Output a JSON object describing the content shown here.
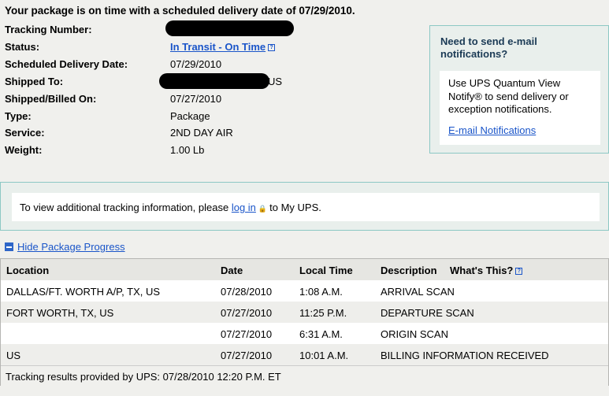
{
  "headline": "Your package is on time with a scheduled delivery date of 07/29/2010.",
  "details": [
    {
      "label": "Tracking Number:",
      "value": ""
    },
    {
      "label": "Status:",
      "value": "In Transit - On Time"
    },
    {
      "label": "Scheduled Delivery Date:",
      "value": "07/29/2010"
    },
    {
      "label": "Shipped To:",
      "value": "US"
    },
    {
      "label": "Shipped/Billed On:",
      "value": "07/27/2010"
    },
    {
      "label": "Type:",
      "value": "Package"
    },
    {
      "label": "Service:",
      "value": "2ND DAY AIR"
    },
    {
      "label": "Weight:",
      "value": "1.00 Lb"
    }
  ],
  "help_icon": "?",
  "notify": {
    "title": "Need to send e-mail notifications?",
    "text": "Use UPS Quantum View Notify® to send delivery or exception notifications.",
    "link": "E-mail Notifications"
  },
  "login": {
    "before": "To view additional tracking information, please",
    "link": "log in",
    "lock_icon": "lock-icon",
    "after": "to My UPS."
  },
  "toggle_label": "Hide Package Progress",
  "progress": {
    "headers": {
      "location": "Location",
      "date": "Date",
      "time": "Local Time",
      "description": "Description",
      "whats_this": "What's This?"
    },
    "rows": [
      {
        "location": "DALLAS/FT. WORTH A/P, TX, US",
        "date": "07/28/2010",
        "time": "1:08 A.M.",
        "description": "ARRIVAL SCAN"
      },
      {
        "location": "FORT WORTH, TX, US",
        "date": "07/27/2010",
        "time": "11:25 P.M.",
        "description": "DEPARTURE SCAN"
      },
      {
        "location": "",
        "date": "07/27/2010",
        "time": "6:31 A.M.",
        "description": "ORIGIN SCAN"
      },
      {
        "location": "US",
        "date": "07/27/2010",
        "time": "10:01 A.M.",
        "description": "BILLING INFORMATION RECEIVED"
      }
    ],
    "footer": "Tracking results provided by UPS:  07/28/2010 12:20 P.M.  ET"
  },
  "colors": {
    "link": "#1a55c9",
    "panel_border": "#8cc8c4",
    "background": "#f0f0ed"
  }
}
